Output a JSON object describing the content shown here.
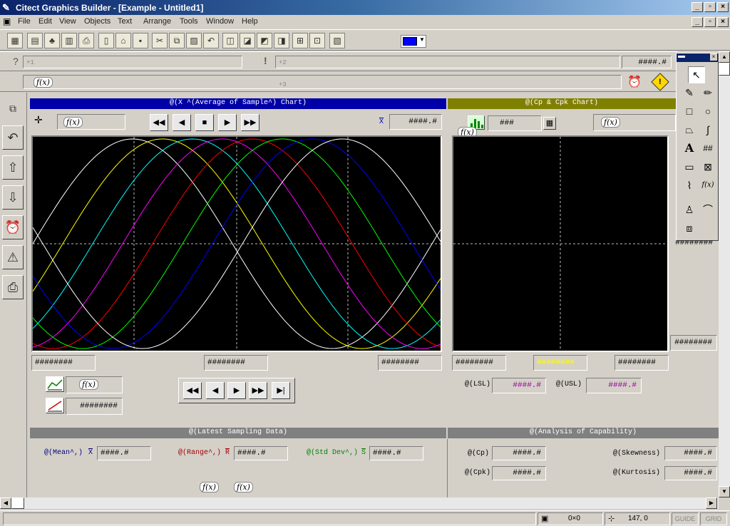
{
  "window": {
    "title": "Citect Graphics Builder - [Example - Untitled1]"
  },
  "menu": [
    "File",
    "Edit",
    "View",
    "Objects",
    "Text",
    "Arrange",
    "Tools",
    "Window",
    "Help"
  ],
  "toolbar": {
    "color_swatch": "#0000ff"
  },
  "row1": {
    "q": "?",
    "f1": "+1",
    "excl": "!",
    "f2": "+2",
    "value": "####.#"
  },
  "row2": {
    "fx": "f(x)",
    "f3": "+3"
  },
  "xbar": {
    "title": "@(X ^(Average of Sample^) Chart)",
    "fx": "f(x)",
    "xbar_symbol": "X",
    "xbar_value": "####.#",
    "bottom_left": "########",
    "bottom_mid": "########",
    "bottom_right": "########",
    "fx2": "f(x)",
    "small_value": "########"
  },
  "cp": {
    "title": "@(Cp & Cpk Chart)",
    "fx": "f(x)",
    "fx2": "f(x)",
    "count": "###",
    "right_top": "########",
    "right_bottom": "########",
    "bottom_left": "########",
    "bottom_mid": "########",
    "bottom_right": "########",
    "lsl_label": "@(LSL)",
    "lsl_value": "####.#",
    "usl_label": "@(USL)",
    "usl_value": "####.#"
  },
  "latest": {
    "title": "@(Latest Sampling Data)",
    "mean_label": "@(Mean^,)",
    "mean_sym": "X",
    "mean_value": "####.#",
    "range_label": "@(Range^,)",
    "range_sym": "R",
    "range_value": "####.#",
    "std_label": "@(Std Dev^,)",
    "std_sym": "S",
    "std_value": "####.#",
    "fx1": "f(x)",
    "fx2": "f(x)"
  },
  "capability": {
    "title": "@(Analysis of Capability)",
    "cp_label": "@(Cp)",
    "cp_value": "####.#",
    "cpk_label": "@(Cpk)",
    "cpk_value": "####.#",
    "skew_label": "@(Skewness)",
    "skew_value": "####.#",
    "kurt_label": "@(Kurtosis)",
    "kurt_value": "####.#"
  },
  "toolbox": {
    "text_tool": "A",
    "number_tool": "##",
    "fx_tool": "f(x)"
  },
  "status": {
    "size": "0×0",
    "position": "147, 0",
    "guide": "GUIDE",
    "grid": "GRID"
  },
  "colors": {
    "series": [
      "#ffffff",
      "#ffff00",
      "#00ffff",
      "#ff00ff",
      "#ff0000",
      "#00ff00",
      "#0000ff",
      "#ffffff"
    ]
  }
}
